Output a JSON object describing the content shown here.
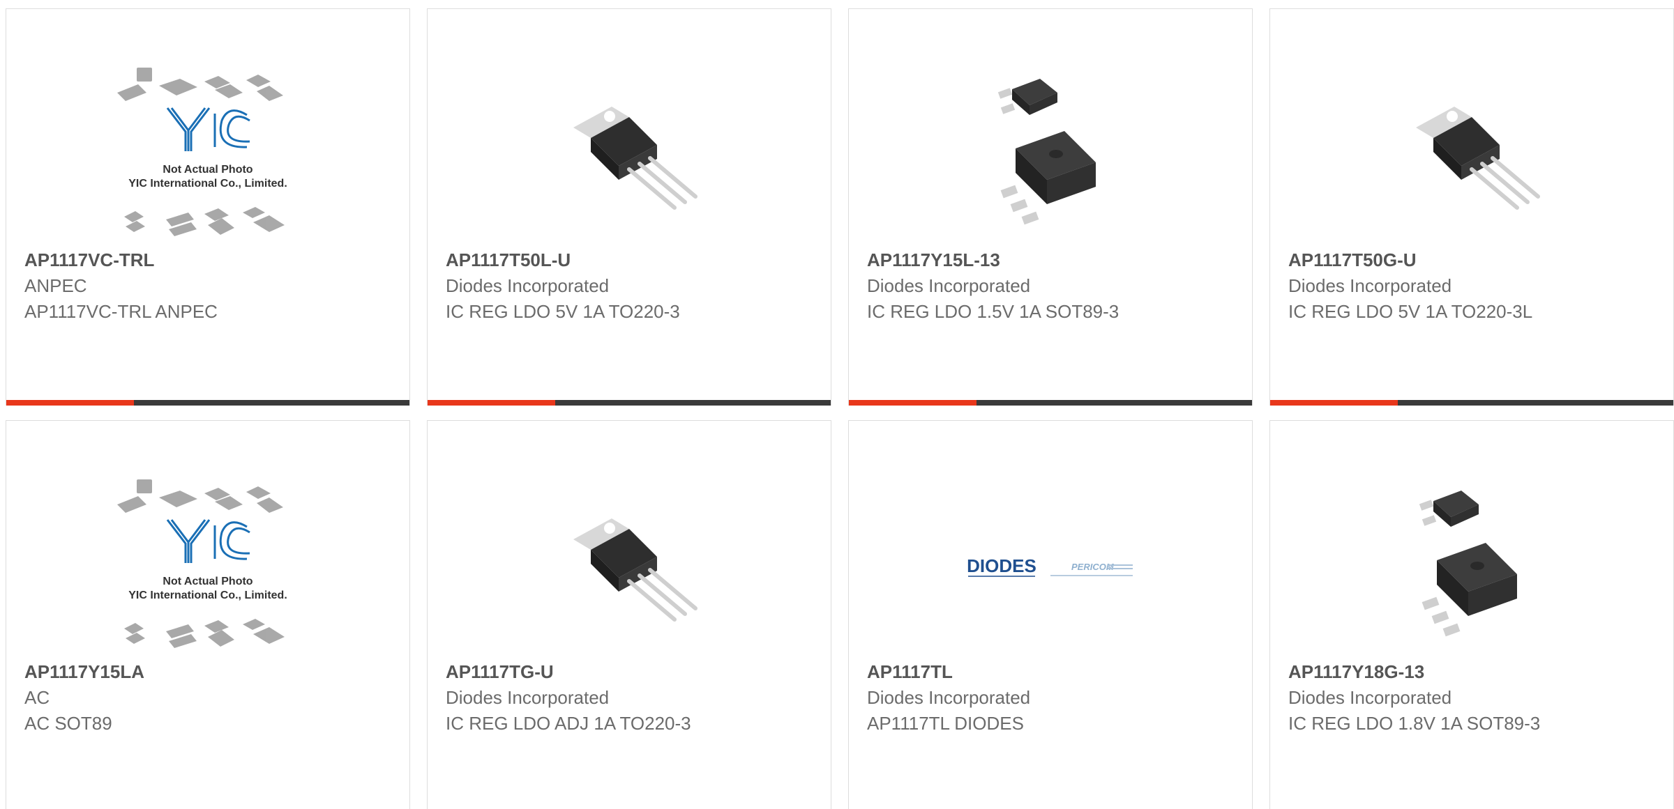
{
  "colors": {
    "accent": "#e8371b",
    "bar": "#3a3a3a",
    "border": "#dddddd"
  },
  "products": [
    {
      "part": "AP1117VC-TRL",
      "manufacturer": "ANPEC",
      "description": "AP1117VC-TRL ANPEC",
      "image": "yic-placeholder",
      "placeholder_line1": "Not Actual Photo",
      "placeholder_line2": "YIC International Co., Limited."
    },
    {
      "part": "AP1117T50L-U",
      "manufacturer": "Diodes Incorporated",
      "description": "IC REG LDO 5V 1A TO220-3",
      "image": "to220-package"
    },
    {
      "part": "AP1117Y15L-13",
      "manufacturer": "Diodes Incorporated",
      "description": "IC REG LDO 1.5V 1A SOT89-3",
      "image": "sot89-package"
    },
    {
      "part": "AP1117T50G-U",
      "manufacturer": "Diodes Incorporated",
      "description": "IC REG LDO 5V 1A TO220-3L",
      "image": "to220-package"
    },
    {
      "part": "AP1117Y15LA",
      "manufacturer": "AC",
      "description": "AC SOT89",
      "image": "yic-placeholder",
      "placeholder_line1": "Not Actual Photo",
      "placeholder_line2": "YIC International Co., Limited."
    },
    {
      "part": "AP1117TG-U",
      "manufacturer": "Diodes Incorporated",
      "description": "IC REG LDO ADJ 1A TO220-3",
      "image": "to220-package"
    },
    {
      "part": "AP1117TL",
      "manufacturer": "Diodes Incorporated",
      "description": "AP1117TL DIODES",
      "image": "diodes-logo",
      "logo_text": "DIODES",
      "logo_text2": "PERICOM"
    },
    {
      "part": "AP1117Y18G-13",
      "manufacturer": "Diodes Incorporated",
      "description": "IC REG LDO 1.8V 1A SOT89-3",
      "image": "sot89-package"
    }
  ]
}
